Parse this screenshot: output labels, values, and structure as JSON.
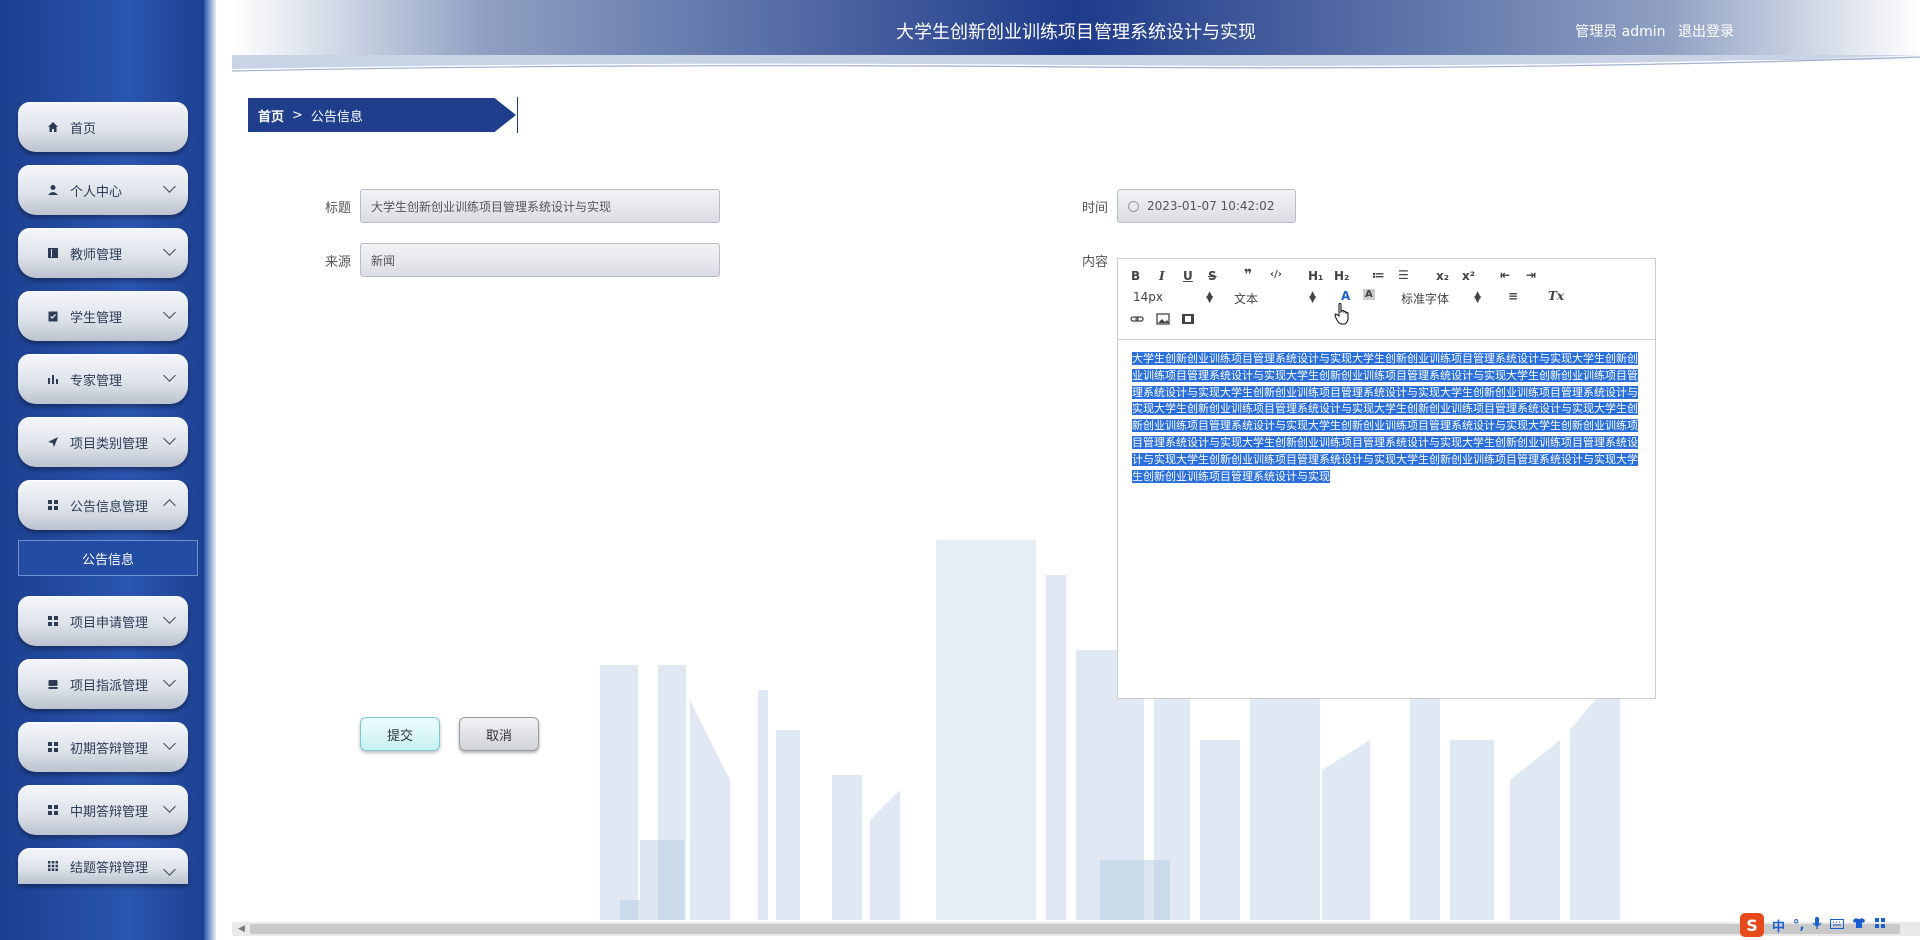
{
  "header": {
    "title": "大学生创新创业训练项目管理系统设计与实现",
    "user": "管理员 admin",
    "logout": "退出登录"
  },
  "sidebar": {
    "items": [
      {
        "label": "首页",
        "icon": "home-icon"
      },
      {
        "label": "个人中心",
        "icon": "user-icon"
      },
      {
        "label": "教师管理",
        "icon": "book-icon"
      },
      {
        "label": "学生管理",
        "icon": "clipboard-icon"
      },
      {
        "label": "专家管理",
        "icon": "bar-chart-icon"
      },
      {
        "label": "项目类别管理",
        "icon": "send-icon"
      },
      {
        "label": "公告信息管理",
        "icon": "grid-icon"
      },
      {
        "label": "项目申请管理",
        "icon": "grid-icon"
      },
      {
        "label": "项目指派管理",
        "icon": "box-icon"
      },
      {
        "label": "初期答辩管理",
        "icon": "grid-icon"
      },
      {
        "label": "中期答辩管理",
        "icon": "grid-icon"
      },
      {
        "label": "结题答辩管理",
        "icon": "apps-icon"
      }
    ],
    "submenu_label": "公告信息"
  },
  "breadcrumb": {
    "home": "首页",
    "sep": ">",
    "current": "公告信息"
  },
  "form": {
    "title_label": "标题",
    "title_value": "大学生创新创业训练项目管理系统设计与实现",
    "source_label": "来源",
    "source_value": "新闻",
    "time_label": "时间",
    "time_value": "2023-01-07 10:42:02",
    "content_label": "内容",
    "content_text": "大学生创新创业训练项目管理系统设计与实现大学生创新创业训练项目管理系统设计与实现大学生创新创业训练项目管理系统设计与实现大学生创新创业训练项目管理系统设计与实现大学生创新创业训练项目管理系统设计与实现大学生创新创业训练项目管理系统设计与实现大学生创新创业训练项目管理系统设计与实现大学生创新创业训练项目管理系统设计与实现大学生创新创业训练项目管理系统设计与实现大学生创新创业训练项目管理系统设计与实现大学生创新创业训练项目管理系统设计与实现大学生创新创业训练项目管理系统设计与实现大学生创新创业训练项目管理系统设计与实现大学生创新创业训练项目管理系统设计与实现大学生创新创业训练项目管理系统设计与实现大学生创新创业训练项目管理系统设计与实现大学生创新创业训练项目管理系统设计与实现",
    "submit": "提交",
    "cancel": "取消"
  },
  "toolbar": {
    "bold": "B",
    "italic": "I",
    "underline": "U",
    "strike": "S",
    "quote": "❞",
    "code": "‹/›",
    "h1": "H₁",
    "h2": "H₂",
    "ordered": "≔",
    "bullet": "☰",
    "sub": "x₂",
    "sup": "x²",
    "outdent": "⇤",
    "indent": "⇥",
    "size": "14px",
    "format": "文本",
    "color": "A",
    "bgcolor": "A",
    "font": "标准字体",
    "align": "≡",
    "clean": "Tx"
  },
  "ime": {
    "logo": "S",
    "lang": "中",
    "punct": "°,"
  }
}
